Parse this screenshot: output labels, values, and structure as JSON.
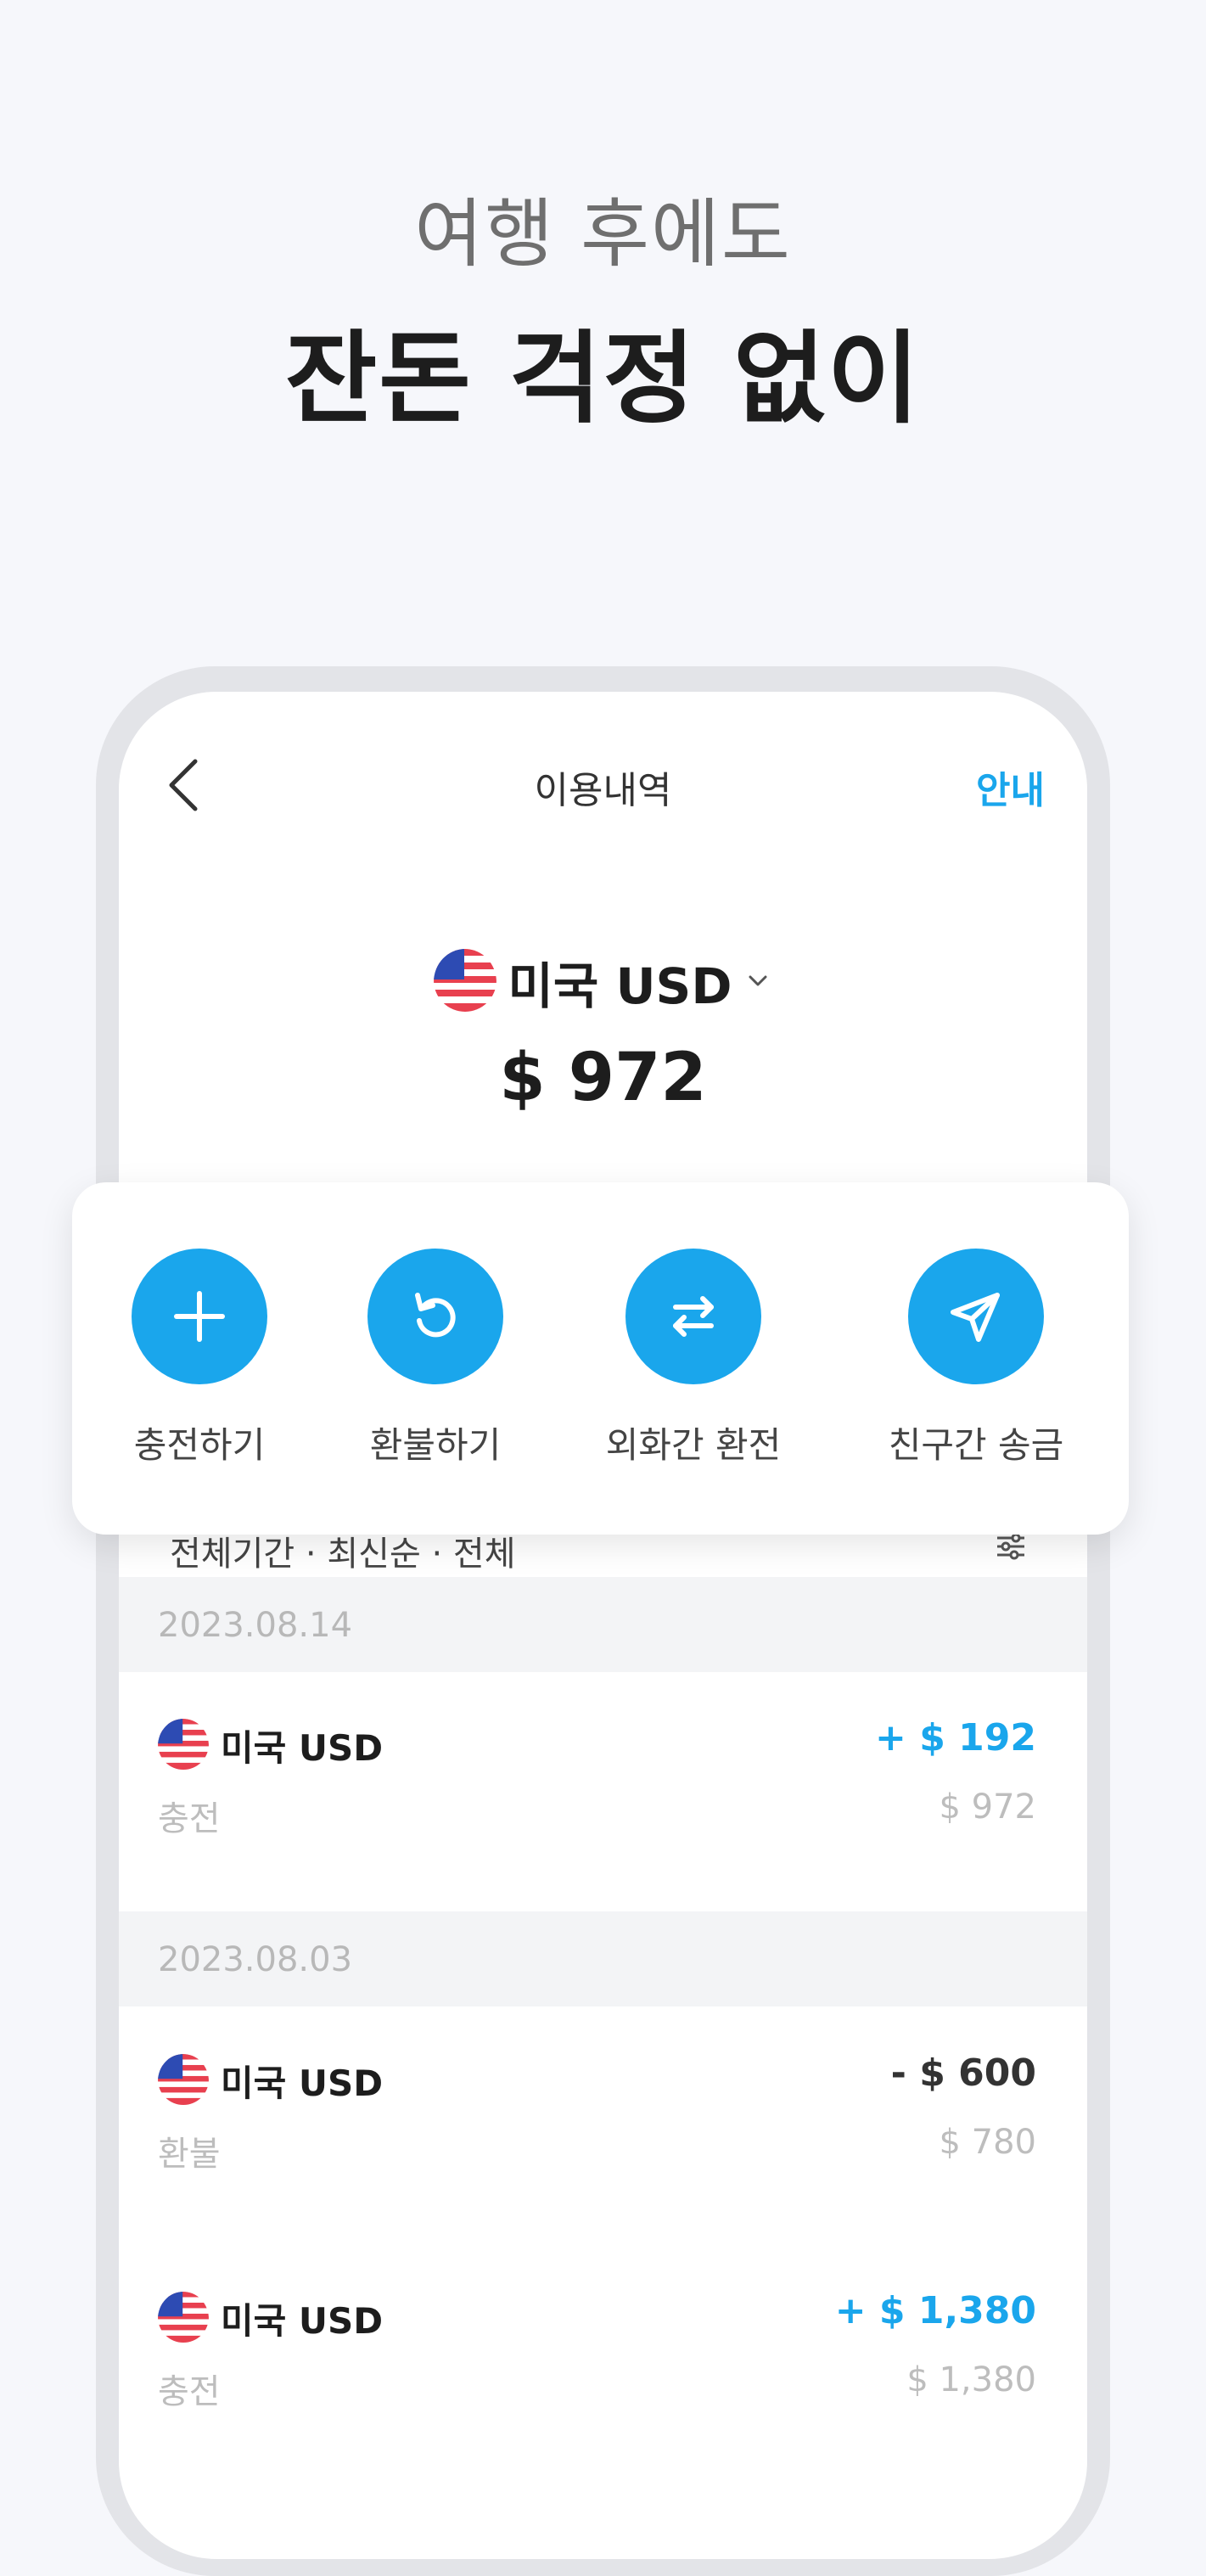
{
  "promo": {
    "subtitle": "여행 후에도",
    "title": "잔돈 걱정 없이"
  },
  "header": {
    "title": "이용내역",
    "info_label": "안내",
    "back_icon": "chevron-left-icon"
  },
  "account": {
    "currency_label": "미국 USD",
    "balance": "$ 972",
    "flag_icon": "us-flag-icon",
    "dropdown_icon": "chevron-down-icon"
  },
  "actions": [
    {
      "label": "충전하기",
      "icon": "plus-icon"
    },
    {
      "label": "환불하기",
      "icon": "refresh-icon"
    },
    {
      "label": "외화간 환전",
      "icon": "swap-arrows-icon"
    },
    {
      "label": "친구간 송금",
      "icon": "send-icon"
    }
  ],
  "filter": {
    "text": "전체기간 · 최신순 · 전체",
    "icon": "filter-sliders-icon"
  },
  "transactions": [
    {
      "date": "2023.08.14",
      "items": [
        {
          "currency": "미국 USD",
          "type": "충전",
          "amount": "+ $ 192",
          "balance": "$ 972",
          "direction": "plus"
        }
      ]
    },
    {
      "date": "2023.08.03",
      "items": [
        {
          "currency": "미국 USD",
          "type": "환불",
          "amount": "- $ 600",
          "balance": "$ 780",
          "direction": "minus"
        },
        {
          "currency": "미국 USD",
          "type": "충전",
          "amount": "+ $ 1,380",
          "balance": "$ 1,380",
          "direction": "plus"
        }
      ]
    }
  ],
  "colors": {
    "accent": "#1aa6ec",
    "background": "#f6f7fb"
  }
}
